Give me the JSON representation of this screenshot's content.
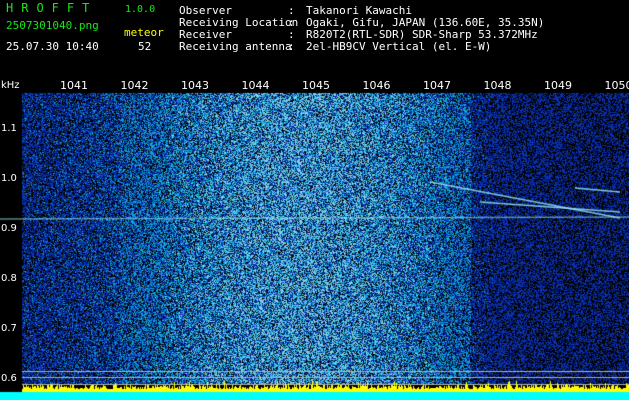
{
  "header": {
    "app_title": "HROFFT",
    "app_version": "1.0.0",
    "file_name": "2507301040.png",
    "mode_label": "meteor",
    "date_time": "25.07.30 10:40",
    "count": "52"
  },
  "info": {
    "labels": "Observer\nReceiving Location\nReceiver\nReceiving antenna",
    "separators": ":\n:\n:\n:",
    "values": "Takanori Kawachi\nOgaki, Gifu, JAPAN (136.60E, 35.35N)\nR820T2(RTL-SDR) SDR-Sharp 53.372MHz\n2el-HB9CV Vertical (el. E-W)"
  },
  "spectrogram": {
    "y_unit": "kHz",
    "time_ticks": [
      "1041",
      "1042",
      "1043",
      "1044",
      "1045",
      "1046",
      "1047",
      "1048",
      "1049",
      "1050"
    ],
    "freq_ticks": [
      "1.1",
      "1.0",
      "0.9",
      "0.8",
      "0.7",
      "0.6"
    ],
    "colors": {
      "background": "#000000",
      "noise_low": "#0a1a8c",
      "noise_high": "#1ec8e6",
      "signal": "#9cf0ff",
      "activity_bar": "#ffff00",
      "baseline": "#00ffff"
    }
  }
}
